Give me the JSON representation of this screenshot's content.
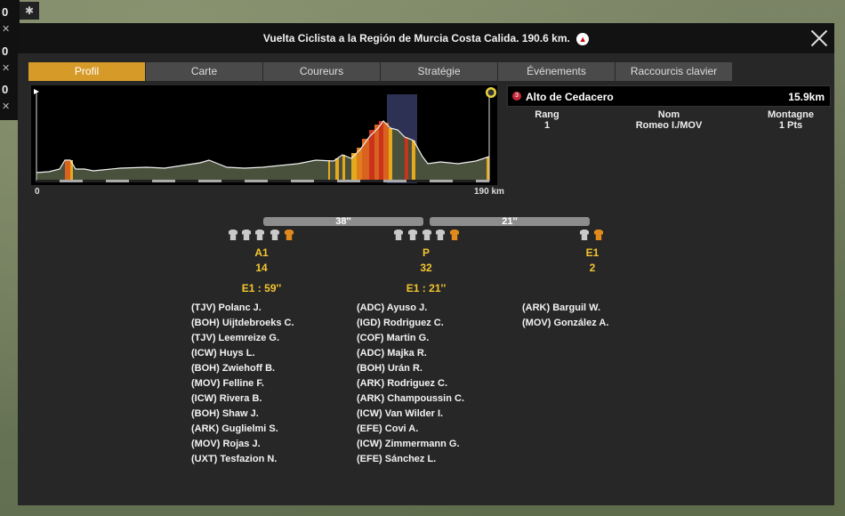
{
  "hud": {
    "counters": [
      "0",
      "0",
      "0"
    ]
  },
  "window": {
    "title": "Vuelta Ciclista a la Región de Murcia Costa Calida. 190.6 km.",
    "close_label": "Close"
  },
  "tabs": [
    {
      "label": "Profil",
      "active": true
    },
    {
      "label": "Carte",
      "active": false
    },
    {
      "label": "Coureurs",
      "active": false
    },
    {
      "label": "Stratégie",
      "active": false
    },
    {
      "label": "Événements",
      "active": false
    },
    {
      "label": "Raccourcis clavier",
      "active": false
    }
  ],
  "profile": {
    "km_start": "0",
    "km_end": "190 km"
  },
  "climb": {
    "category": "3",
    "name": "Alto de Cedacero",
    "distance": "15.9km",
    "headers": [
      "Rang",
      "Nom",
      "Montagne"
    ],
    "row": [
      "1",
      "Romeo I./MOV",
      "1 Pts"
    ]
  },
  "gaps": [
    "38''",
    "21''"
  ],
  "groups": [
    {
      "label": "A1",
      "count": "14",
      "time": "E1 : 59''",
      "riders": [
        "(TJV) Polanc J.",
        "(BOH) Uijtdebroeks C.",
        "(TJV) Leemreize G.",
        "(ICW) Huys L.",
        "(BOH) Zwiehoff B.",
        "(MOV) Felline F.",
        "(ICW) Rivera B.",
        "(BOH) Shaw J.",
        "(ARK) Guglielmi S.",
        "(MOV) Rojas J.",
        "(UXT) Tesfazion N."
      ]
    },
    {
      "label": "P",
      "count": "32",
      "time": "E1 : 21''",
      "riders": [
        "(ADC) Ayuso J.",
        "(IGD) Rodriguez C.",
        "(COF) Martin G.",
        "(ADC) Majka R.",
        "(BOH) Urán R.",
        "(ARK) Rodriguez C.",
        "(ARK) Champoussin C.",
        "(ICW) Van Wilder I.",
        "(EFE) Covi A.",
        "(ICW) Zimmermann G.",
        "(EFE) Sánchez L."
      ]
    },
    {
      "label": "E1",
      "count": "2",
      "time": "",
      "riders": [
        "(ARK) Barguil W.",
        "(MOV) González A."
      ]
    }
  ],
  "colors": {
    "accent": "#d69a29",
    "group_text": "#f3c630",
    "climb_category": "#c42a3c"
  }
}
